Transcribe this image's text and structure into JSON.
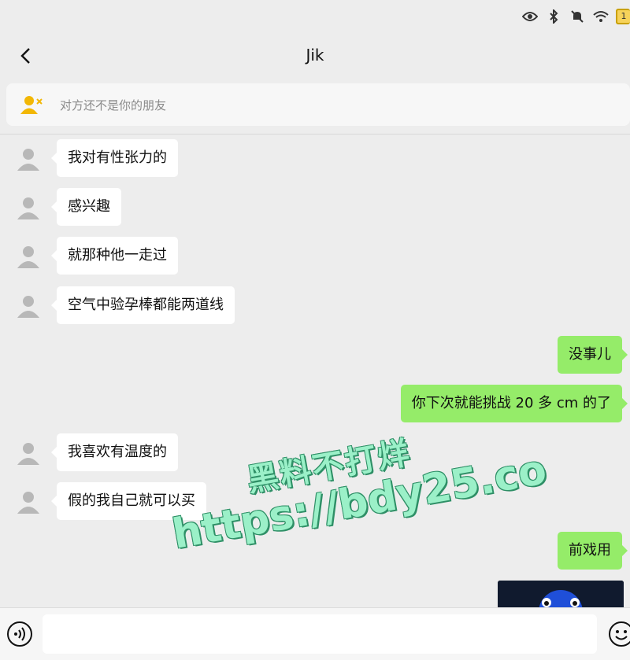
{
  "status_bar": {
    "icons": [
      "eye-icon",
      "bluetooth-icon",
      "mute-icon",
      "wifi-icon",
      "battery-icon"
    ],
    "battery_level": "1"
  },
  "header": {
    "title": "Jik"
  },
  "notice": {
    "icon": "add-friend-icon",
    "text": "对方还不是你的朋友"
  },
  "messages": [
    {
      "side": "in",
      "text": "我对有性张力的"
    },
    {
      "side": "in",
      "text": "感兴趣"
    },
    {
      "side": "in",
      "text": "就那种他一走过"
    },
    {
      "side": "in",
      "text": "空气中验孕棒都能两道线"
    },
    {
      "side": "out",
      "text": "没事儿"
    },
    {
      "side": "out",
      "text": "你下次就能挑战 20 多 cm 的了"
    },
    {
      "side": "in",
      "text": "我喜欢有温度的"
    },
    {
      "side": "in",
      "text": "假的我自己就可以买"
    },
    {
      "side": "out",
      "text": "前戏用"
    },
    {
      "side": "out",
      "type": "image"
    }
  ],
  "watermark": {
    "line1": "黑料不打烊",
    "line2": "https://bdy25.co"
  },
  "input_bar": {
    "placeholder": "",
    "value": ""
  },
  "colors": {
    "background": "#ededed",
    "incoming_bubble": "#ffffff",
    "outgoing_bubble": "#95ec69",
    "watermark": "#9bf0c8"
  }
}
